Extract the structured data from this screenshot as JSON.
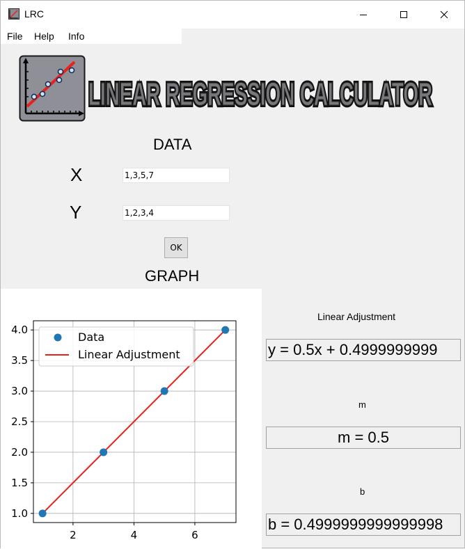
{
  "window": {
    "title": "LRC",
    "icon": "chart-app-icon"
  },
  "menu": {
    "items": [
      "File",
      "Help",
      "Info"
    ]
  },
  "logo": {
    "title": "LINEAR REGRESSION CALCULATOR"
  },
  "data_section": {
    "heading": "DATA",
    "x_label": "X",
    "y_label": "Y",
    "x_value": "1,3,5,7",
    "y_value": "1,2,3,4",
    "ok_label": "OK"
  },
  "graph_section": {
    "heading": "GRAPH"
  },
  "results": {
    "linear_adjustment_label": "Linear Adjustment",
    "equation": "y = 0.5x + 0.4999999999",
    "m_label": "m",
    "m_value": "m = 0.5",
    "b_label": "b",
    "b_value": "b = 0.4999999999999998"
  },
  "colors": {
    "data_points": "#1f77b4",
    "fit_line": "#e8221b",
    "grid": "#b0b0b0"
  },
  "chart_data": {
    "type": "scatter",
    "title": "",
    "xlabel": "",
    "ylabel": "",
    "xlim": [
      0.7,
      7.35
    ],
    "ylim": [
      0.85,
      4.15
    ],
    "xticks": [
      2,
      4,
      6
    ],
    "yticks": [
      1.0,
      1.5,
      2.0,
      2.5,
      3.0,
      3.5,
      4.0
    ],
    "xtick_labels": [
      "2",
      "4",
      "6"
    ],
    "ytick_labels": [
      "1.0",
      "1.5",
      "2.0",
      "2.5",
      "3.0",
      "3.5",
      "4.0"
    ],
    "grid": true,
    "legend_position": "top-left",
    "series": [
      {
        "name": "Data",
        "kind": "scatter",
        "x": [
          1,
          3,
          5,
          7
        ],
        "y": [
          1,
          2,
          3,
          4
        ]
      },
      {
        "name": "Linear Adjustment",
        "kind": "line",
        "x": [
          1,
          7
        ],
        "y": [
          1.0,
          4.0
        ]
      }
    ]
  }
}
